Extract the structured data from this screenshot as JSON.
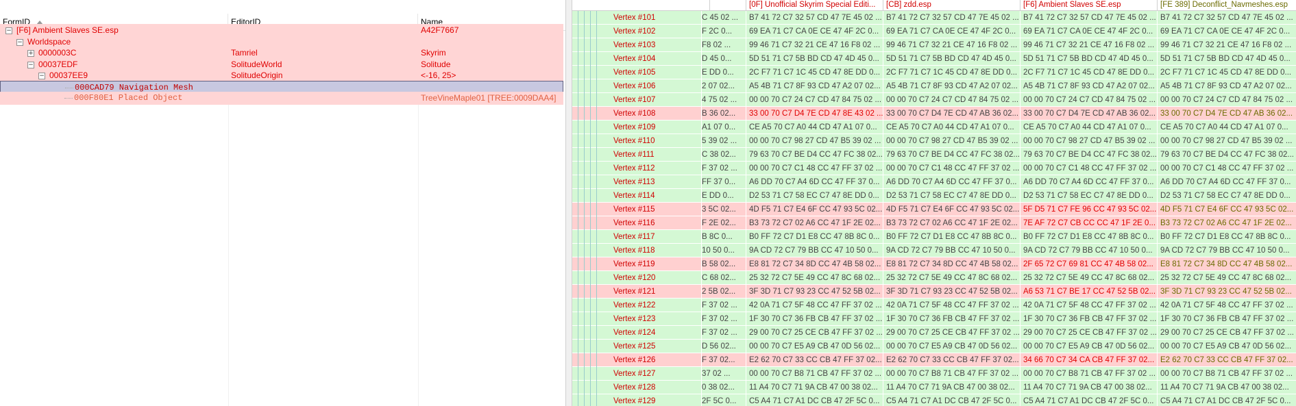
{
  "tree": {
    "columns": [
      "FormID",
      "EditorID",
      "Name"
    ],
    "rows": [
      {
        "formid": "[F6] Ambient Slaves SE.esp",
        "editorid": "",
        "name": "A42F7667",
        "style": "pink",
        "toggle": "−"
      },
      {
        "formid": "Worldspace",
        "editorid": "",
        "name": "",
        "style": "pink",
        "toggle": "−"
      },
      {
        "formid": "0000003C",
        "editorid": "Tamriel",
        "name": "Skyrim",
        "style": "pink",
        "toggle": "+"
      },
      {
        "formid": "00037EDF",
        "editorid": "SolitudeWorld",
        "name": "Solitude",
        "style": "pink",
        "toggle": "−"
      },
      {
        "formid": "00037EE9",
        "editorid": "SolitudeOrigin",
        "name": "<-16, 25>",
        "style": "pink",
        "toggle": "−"
      },
      {
        "formid": "000CAD79  Navigation Mesh",
        "editorid": "",
        "name": "",
        "style": "sel",
        "toggle": ""
      },
      {
        "formid": "000F80E1  Placed Object",
        "editorid": "",
        "name": "TreeVineMaple01 [TREE:0009DAA4]",
        "style": "pink",
        "toggle": ""
      }
    ]
  },
  "grid": {
    "headers": [
      "[0F] Unofficial Skyrim Special Editi...",
      "[CB] zdd.esp",
      "[F6] Ambient Slaves SE.esp",
      "[FE 389] Deconflict_Navmeshes.esp"
    ],
    "rows": [
      {
        "name": "Vertex #101",
        "cut": "C 45 02 ...",
        "v": [
          "B7 41 72 C7 32 57 CD 47 7E 45 02 ...",
          "B7 41 72 C7 32 57 CD 47 7E 45 02 ...",
          "B7 41 72 C7 32 57 CD 47 7E 45 02 ...",
          "B7 41 72 C7 32 57 CD 47 7E 45 02 ..."
        ],
        "style": "green",
        "diff": []
      },
      {
        "name": "Vertex #102",
        "cut": "F 2C 0...",
        "v": [
          "69 EA 71 C7 CA 0E CE 47 4F 2C 0...",
          "69 EA 71 C7 CA 0E CE 47 4F 2C 0...",
          "69 EA 71 C7 CA 0E CE 47 4F 2C 0...",
          "69 EA 71 C7 CA 0E CE 47 4F 2C 0..."
        ],
        "style": "green",
        "diff": []
      },
      {
        "name": "Vertex #103",
        "cut": "F8 02 ...",
        "v": [
          "99 46 71 C7 32 21 CE 47 16 F8 02 ...",
          "99 46 71 C7 32 21 CE 47 16 F8 02 ...",
          "99 46 71 C7 32 21 CE 47 16 F8 02 ...",
          "99 46 71 C7 32 21 CE 47 16 F8 02 ..."
        ],
        "style": "green",
        "diff": []
      },
      {
        "name": "Vertex #104",
        "cut": "D 45 0...",
        "v": [
          "5D 51 71 C7 5B BD CD 47 4D 45 0...",
          "5D 51 71 C7 5B BD CD 47 4D 45 0...",
          "5D 51 71 C7 5B BD CD 47 4D 45 0...",
          "5D 51 71 C7 5B BD CD 47 4D 45 0..."
        ],
        "style": "green",
        "diff": []
      },
      {
        "name": "Vertex #105",
        "cut": "E DD 0...",
        "v": [
          "2C F7 71 C7 1C 45 CD 47 8E DD 0...",
          "2C F7 71 C7 1C 45 CD 47 8E DD 0...",
          "2C F7 71 C7 1C 45 CD 47 8E DD 0...",
          "2C F7 71 C7 1C 45 CD 47 8E DD 0..."
        ],
        "style": "green",
        "diff": []
      },
      {
        "name": "Vertex #106",
        "cut": "2 07 02...",
        "v": [
          "A5 4B 71 C7 8F 93 CD 47 A2 07 02...",
          "A5 4B 71 C7 8F 93 CD 47 A2 07 02...",
          "A5 4B 71 C7 8F 93 CD 47 A2 07 02...",
          "A5 4B 71 C7 8F 93 CD 47 A2 07 02..."
        ],
        "style": "green",
        "diff": []
      },
      {
        "name": "Vertex #107",
        "cut": "4 75 02 ...",
        "v": [
          "00 00 70 C7 24 C7 CD 47 84 75 02 ...",
          "00 00 70 C7 24 C7 CD 47 84 75 02 ...",
          "00 00 70 C7 24 C7 CD 47 84 75 02 ...",
          "00 00 70 C7 24 C7 CD 47 84 75 02 ..."
        ],
        "style": "green",
        "diff": []
      },
      {
        "name": "Vertex #108",
        "cut": "B 36 02...",
        "v": [
          "33 00 70 C7 D4 7E CD 47 8E 43 02 ...",
          "33 00 70 C7 D4 7E CD 47 AB 36 02...",
          "33 00 70 C7 D4 7E CD 47 AB 36 02...",
          "33 00 70 C7 D4 7E CD 47 AB 36 02..."
        ],
        "style": "pink",
        "diff": [
          0
        ],
        "olive": [
          3
        ]
      },
      {
        "name": "Vertex #109",
        "cut": "A1 07 0...",
        "v": [
          "CE A5 70 C7 A0 44 CD 47 A1 07 0...",
          "CE A5 70 C7 A0 44 CD 47 A1 07 0...",
          "CE A5 70 C7 A0 44 CD 47 A1 07 0...",
          "CE A5 70 C7 A0 44 CD 47 A1 07 0..."
        ],
        "style": "green",
        "diff": []
      },
      {
        "name": "Vertex #110",
        "cut": "5 39 02 ...",
        "v": [
          "00 00 70 C7 98 27 CD 47 B5 39 02 ...",
          "00 00 70 C7 98 27 CD 47 B5 39 02 ...",
          "00 00 70 C7 98 27 CD 47 B5 39 02 ...",
          "00 00 70 C7 98 27 CD 47 B5 39 02 ..."
        ],
        "style": "green",
        "diff": []
      },
      {
        "name": "Vertex #111",
        "cut": "C 38 02...",
        "v": [
          "79 63 70 C7 BE D4 CC 47 FC 38 02...",
          "79 63 70 C7 BE D4 CC 47 FC 38 02...",
          "79 63 70 C7 BE D4 CC 47 FC 38 02...",
          "79 63 70 C7 BE D4 CC 47 FC 38 02..."
        ],
        "style": "green",
        "diff": []
      },
      {
        "name": "Vertex #112",
        "cut": "F 37 02 ...",
        "v": [
          "00 00 70 C7 C1 48 CC 47 FF 37 02 ...",
          "00 00 70 C7 C1 48 CC 47 FF 37 02 ...",
          "00 00 70 C7 C1 48 CC 47 FF 37 02 ...",
          "00 00 70 C7 C1 48 CC 47 FF 37 02 ..."
        ],
        "style": "green",
        "diff": []
      },
      {
        "name": "Vertex #113",
        "cut": "FF 37 0...",
        "v": [
          "A6 DD 70 C7 A4 6D CC 47 FF 37 0...",
          "A6 DD 70 C7 A4 6D CC 47 FF 37 0...",
          "A6 DD 70 C7 A4 6D CC 47 FF 37 0...",
          "A6 DD 70 C7 A4 6D CC 47 FF 37 0..."
        ],
        "style": "green",
        "diff": []
      },
      {
        "name": "Vertex #114",
        "cut": "E DD 0...",
        "v": [
          "D2 53 71 C7 58 EC C7 47 8E DD 0...",
          "D2 53 71 C7 58 EC C7 47 8E DD 0...",
          "D2 53 71 C7 58 EC C7 47 8E DD 0...",
          "D2 53 71 C7 58 EC C7 47 8E DD 0..."
        ],
        "style": "green",
        "diff": []
      },
      {
        "name": "Vertex #115",
        "cut": "3 5C 02...",
        "v": [
          "4D F5 71 C7 E4 6F CC 47 93 5C 02...",
          "4D F5 71 C7 E4 6F CC 47 93 5C 02...",
          "5F D5 71 C7 FE 96 CC 47 93 5C 02...",
          "4D F5 71 C7 E4 6F CC 47 93 5C 02..."
        ],
        "style": "pink",
        "diff": [
          2
        ],
        "olive": [
          3
        ]
      },
      {
        "name": "Vertex #116",
        "cut": "F 2E 02...",
        "v": [
          "B3 73 72 C7 02 A6 CC 47 1F 2E 02...",
          "B3 73 72 C7 02 A6 CC 47 1F 2E 02...",
          "7E AF 72 C7 CB CC CC 47 1F 2E 0...",
          "B3 73 72 C7 02 A6 CC 47 1F 2E 02..."
        ],
        "style": "pink",
        "diff": [
          2
        ],
        "olive": [
          3
        ]
      },
      {
        "name": "Vertex #117",
        "cut": "B 8C 0...",
        "v": [
          "B0 FF 72 C7 D1 E8 CC 47 8B 8C 0...",
          "B0 FF 72 C7 D1 E8 CC 47 8B 8C 0...",
          "B0 FF 72 C7 D1 E8 CC 47 8B 8C 0...",
          "B0 FF 72 C7 D1 E8 CC 47 8B 8C 0..."
        ],
        "style": "green",
        "diff": []
      },
      {
        "name": "Vertex #118",
        "cut": "10 50 0...",
        "v": [
          "9A CD 72 C7 79 BB CC 47 10 50 0...",
          "9A CD 72 C7 79 BB CC 47 10 50 0...",
          "9A CD 72 C7 79 BB CC 47 10 50 0...",
          "9A CD 72 C7 79 BB CC 47 10 50 0..."
        ],
        "style": "green",
        "diff": []
      },
      {
        "name": "Vertex #119",
        "cut": "B 58 02...",
        "v": [
          "E8 81 72 C7 34 8D CC 47 4B 58 02...",
          "E8 81 72 C7 34 8D CC 47 4B 58 02...",
          "2F 65 72 C7 69 81 CC 47 4B 58 02...",
          "E8 81 72 C7 34 8D CC 47 4B 58 02..."
        ],
        "style": "pink",
        "diff": [
          2
        ],
        "olive": [
          3
        ]
      },
      {
        "name": "Vertex #120",
        "cut": "C 68 02...",
        "v": [
          "25 32 72 C7 5E 49 CC 47 8C 68 02...",
          "25 32 72 C7 5E 49 CC 47 8C 68 02...",
          "25 32 72 C7 5E 49 CC 47 8C 68 02...",
          "25 32 72 C7 5E 49 CC 47 8C 68 02..."
        ],
        "style": "green",
        "diff": []
      },
      {
        "name": "Vertex #121",
        "cut": "2 5B 02...",
        "v": [
          "3F 3D 71 C7 93 23 CC 47 52 5B 02...",
          "3F 3D 71 C7 93 23 CC 47 52 5B 02...",
          "A6 53 71 C7 BE 17 CC 47 52 5B 02...",
          "3F 3D 71 C7 93 23 CC 47 52 5B 02..."
        ],
        "style": "pink",
        "diff": [
          2
        ],
        "olive": [
          3
        ]
      },
      {
        "name": "Vertex #122",
        "cut": "F 37 02 ...",
        "v": [
          "42 0A 71 C7 5F 48 CC 47 FF 37 02 ...",
          "42 0A 71 C7 5F 48 CC 47 FF 37 02 ...",
          "42 0A 71 C7 5F 48 CC 47 FF 37 02 ...",
          "42 0A 71 C7 5F 48 CC 47 FF 37 02 ..."
        ],
        "style": "green",
        "diff": []
      },
      {
        "name": "Vertex #123",
        "cut": "F 37 02 ...",
        "v": [
          "1F 30 70 C7 36 FB CB 47 FF 37 02 ...",
          "1F 30 70 C7 36 FB CB 47 FF 37 02 ...",
          "1F 30 70 C7 36 FB CB 47 FF 37 02 ...",
          "1F 30 70 C7 36 FB CB 47 FF 37 02 ..."
        ],
        "style": "green",
        "diff": []
      },
      {
        "name": "Vertex #124",
        "cut": "F 37 02 ...",
        "v": [
          "29 00 70 C7 25 CE CB 47 FF 37 02 ...",
          "29 00 70 C7 25 CE CB 47 FF 37 02 ...",
          "29 00 70 C7 25 CE CB 47 FF 37 02 ...",
          "29 00 70 C7 25 CE CB 47 FF 37 02 ..."
        ],
        "style": "green",
        "diff": []
      },
      {
        "name": "Vertex #125",
        "cut": "D 56 02...",
        "v": [
          "00 00 70 C7 E5 A9 CB 47 0D 56 02...",
          "00 00 70 C7 E5 A9 CB 47 0D 56 02...",
          "00 00 70 C7 E5 A9 CB 47 0D 56 02...",
          "00 00 70 C7 E5 A9 CB 47 0D 56 02..."
        ],
        "style": "green",
        "diff": []
      },
      {
        "name": "Vertex #126",
        "cut": "F 37 02...",
        "v": [
          "E2 62 70 C7 33 CC CB 47 FF 37 02...",
          "E2 62 70 C7 33 CC CB 47 FF 37 02...",
          "34 66 70 C7 34 CA CB 47 FF 37 02...",
          "E2 62 70 C7 33 CC CB 47 FF 37 02..."
        ],
        "style": "pink",
        "diff": [
          2
        ],
        "olive": [
          3
        ]
      },
      {
        "name": "Vertex #127",
        "cut": "37 02 ...",
        "v": [
          "00 00 70 C7 B8 71 CB 47 FF 37 02 ...",
          "00 00 70 C7 B8 71 CB 47 FF 37 02 ...",
          "00 00 70 C7 B8 71 CB 47 FF 37 02 ...",
          "00 00 70 C7 B8 71 CB 47 FF 37 02 ..."
        ],
        "style": "green",
        "diff": []
      },
      {
        "name": "Vertex #128",
        "cut": "0 38 02...",
        "v": [
          "11 A4 70 C7 71 9A CB 47 00 38 02...",
          "11 A4 70 C7 71 9A CB 47 00 38 02...",
          "11 A4 70 C7 71 9A CB 47 00 38 02...",
          "11 A4 70 C7 71 9A CB 47 00 38 02..."
        ],
        "style": "green",
        "diff": []
      },
      {
        "name": "Vertex #129",
        "cut": "2F 5C 0...",
        "v": [
          "C5 A4 71 C7 A1 DC CB 47 2F 5C 0...",
          "C5 A4 71 C7 A1 DC CB 47 2F 5C 0...",
          "C5 A4 71 C7 A1 DC CB 47 2F 5C 0...",
          "C5 A4 71 C7 A1 DC CB 47 2F 5C 0..."
        ],
        "style": "green",
        "diff": []
      }
    ]
  },
  "colors": {
    "accent_red": "#e00000",
    "row_pink": "#ffd5d5",
    "row_green": "#d4f8d4",
    "selected": "#c8c8e0"
  },
  "icons": {
    "sort": "sort-ascending-icon",
    "expand": "plus-icon",
    "collapse": "minus-icon"
  }
}
